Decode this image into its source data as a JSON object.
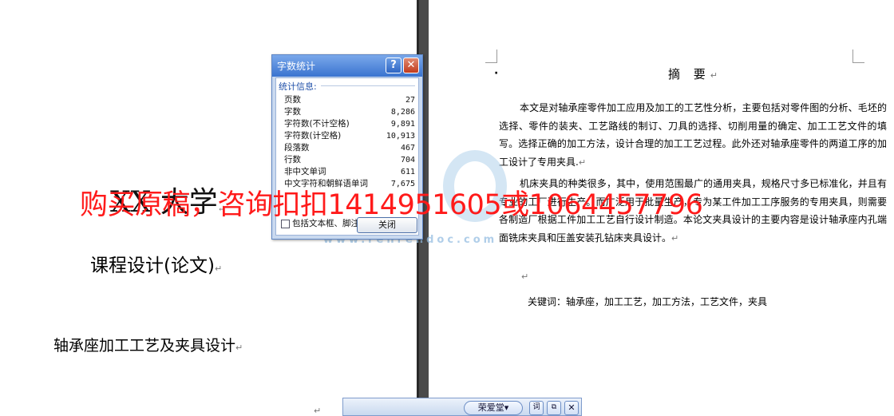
{
  "left_page": {
    "university": "XX 大学",
    "course": "课程设计(论文)",
    "thesis_title": "轴承座加工工艺及夹具设计"
  },
  "paragraph_mark": "↵",
  "right_page": {
    "abstract_title": "摘  要",
    "paragraphs": [
      "本文是对轴承座零件加工应用及加工的工艺性分析，主要包括对零件图的分析、毛坯的选择、零件的装夹、工艺路线的制订、刀具的选择、切削用量的确定、加工工艺文件的填写。选择正确的加工方法，设计合理的加工工艺过程。此外还对轴承座零件的两道工序的加工设计了专用夹具.",
      "机床夹具的种类很多，其中，使用范围最广的通用夹具，规格尺寸多已标准化，并且有专业的工厂进行生产。而广泛用于批量生产，专为某工件加工工序服务的专用夹具，则需要各制造厂根据工件加工工艺自行设计制造。本论文夹具设计的主要内容是设计轴承座内孔端面铣床夹具和压盖安装孔钻床夹具设计。"
    ],
    "keywords": "关键词：轴承座，加工工艺，加工方法，工艺文件，夹具"
  },
  "dialog": {
    "title": "字数统计",
    "help": "?",
    "close_x": "✕",
    "group_label": "统计信息:",
    "stats": [
      {
        "label": "页数",
        "value": "27"
      },
      {
        "label": "字数",
        "value": "8,286"
      },
      {
        "label": "字符数(不计空格)",
        "value": "9,891"
      },
      {
        "label": "字符数(计空格)",
        "value": "10,913"
      },
      {
        "label": "段落数",
        "value": "467"
      },
      {
        "label": "行数",
        "value": "704"
      },
      {
        "label": "非中文单词",
        "value": "611"
      },
      {
        "label": "中文字符和朝鲜语单词",
        "value": "7,675"
      }
    ],
    "checkbox_label": "包括文本框、脚注和尾注(F)",
    "checkbox_checked": false,
    "close_button": "关闭"
  },
  "watermark": {
    "text": "购买原稿，咨询扣扣1414951605或1064457796",
    "url": "www.renrendoc.com"
  },
  "ime_bar": {
    "name": "荣爱堂▾",
    "word_icon": "词",
    "copy_icon": "⧉",
    "close_icon": "✕"
  }
}
